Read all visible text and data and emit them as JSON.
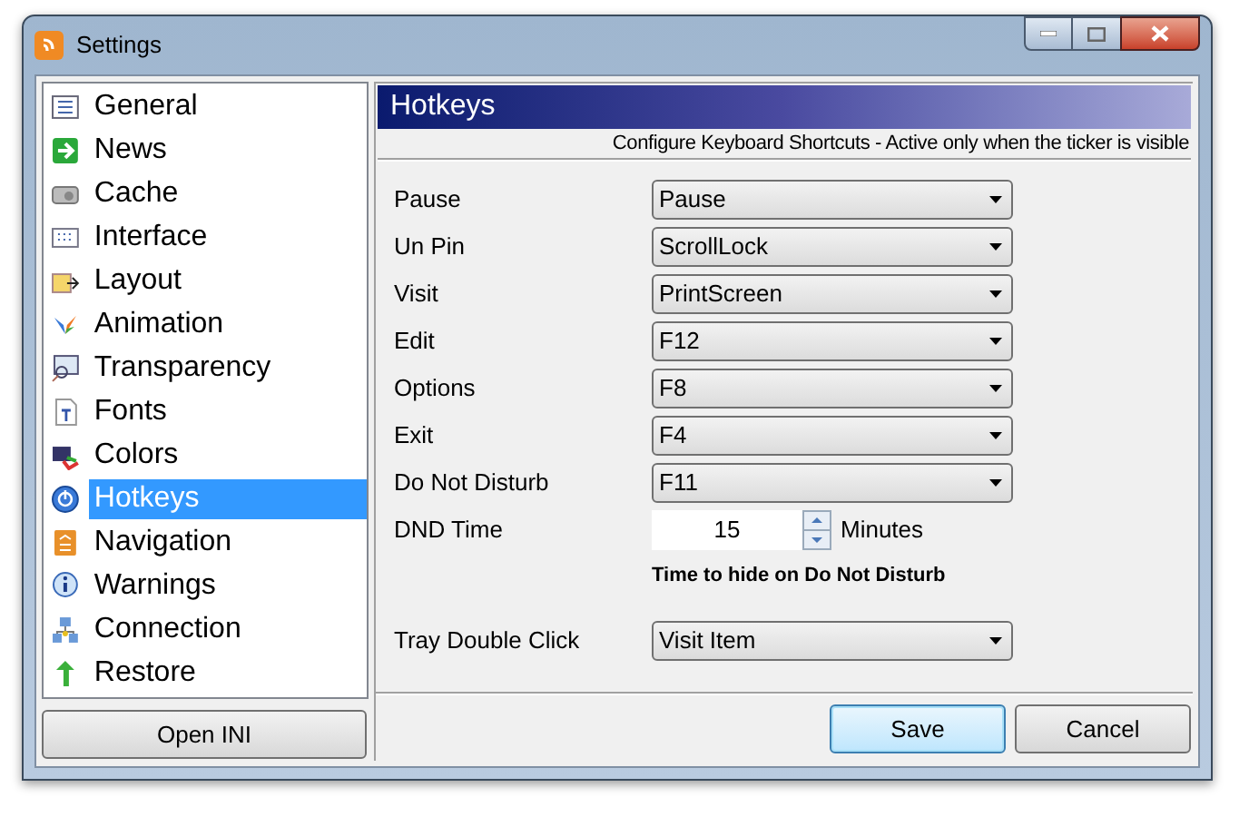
{
  "window": {
    "title": "Settings"
  },
  "sidebar": {
    "items": [
      {
        "label": "General",
        "selected": false
      },
      {
        "label": "News",
        "selected": false
      },
      {
        "label": "Cache",
        "selected": false
      },
      {
        "label": "Interface",
        "selected": false
      },
      {
        "label": "Layout",
        "selected": false
      },
      {
        "label": "Animation",
        "selected": false
      },
      {
        "label": "Transparency",
        "selected": false
      },
      {
        "label": "Fonts",
        "selected": false
      },
      {
        "label": "Colors",
        "selected": false
      },
      {
        "label": "Hotkeys",
        "selected": true
      },
      {
        "label": "Navigation",
        "selected": false
      },
      {
        "label": "Warnings",
        "selected": false
      },
      {
        "label": "Connection",
        "selected": false
      },
      {
        "label": "Restore",
        "selected": false
      }
    ],
    "button": "Open INI"
  },
  "panel": {
    "title": "Hotkeys",
    "subtitle": "Configure Keyboard Shortcuts - Active only when the ticker is visible",
    "hotkeys": [
      {
        "label": "Pause",
        "value": "Pause"
      },
      {
        "label": "Un Pin",
        "value": "ScrollLock"
      },
      {
        "label": "Visit",
        "value": "PrintScreen"
      },
      {
        "label": "Edit",
        "value": "F12"
      },
      {
        "label": "Options",
        "value": "F8"
      },
      {
        "label": "Exit",
        "value": "F4"
      },
      {
        "label": "Do Not Disturb",
        "value": "F11"
      }
    ],
    "dnd_time": {
      "label": "DND Time",
      "value": "15",
      "unit": "Minutes",
      "note": "Time to hide on Do Not Disturb"
    },
    "tray": {
      "label": "Tray Double Click",
      "value": "Visit Item"
    }
  },
  "buttons": [
    {
      "label": "Save",
      "default": true
    },
    {
      "label": "Cancel",
      "default": false
    }
  ]
}
